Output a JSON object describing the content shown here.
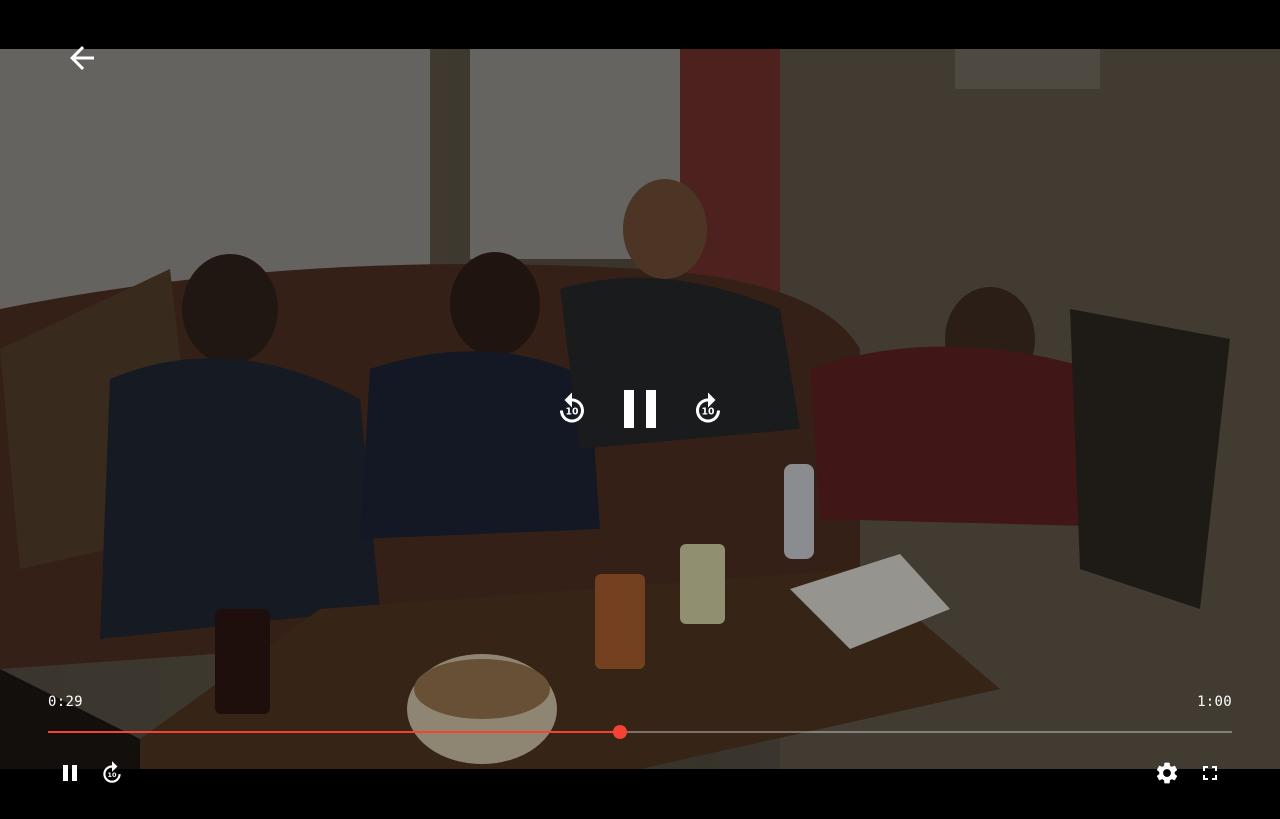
{
  "player": {
    "current_time": "0:29",
    "duration": "1:00",
    "progress_fraction": 0.4833,
    "accent_color": "#f44336",
    "state": "playing",
    "skip_seconds_label": "10"
  },
  "icons": {
    "back": "arrow-left-icon",
    "center_rewind": "replay-10-icon",
    "center_play_pause": "pause-icon",
    "center_forward": "forward-10-icon",
    "bottom_play_pause": "pause-icon",
    "bottom_forward": "forward-10-icon",
    "settings": "gear-icon",
    "fullscreen": "fullscreen-icon"
  }
}
